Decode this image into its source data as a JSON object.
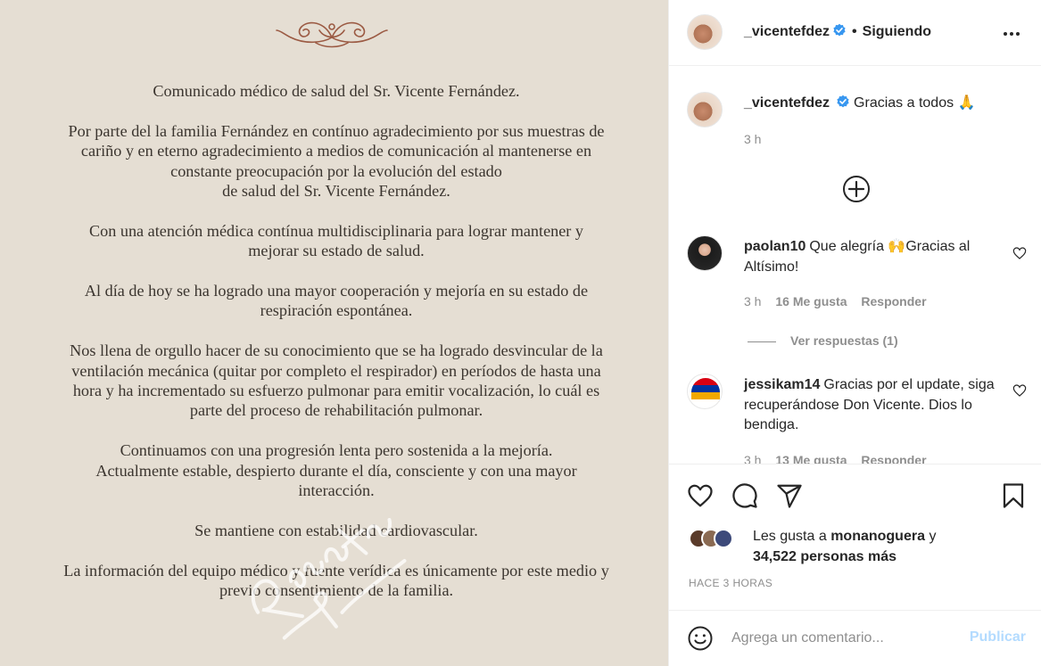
{
  "post": {
    "author": "_vicentefdez",
    "follow_separator": "•",
    "follow_status": "Siguiendo",
    "image": {
      "paragraphs": [
        "Comunicado médico de salud del Sr. Vicente Fernández.",
        "Por parte del la familia Fernández en contínuo agradecimiento por sus muestras de\ncariño y en eterno agradecimiento a medios de comunicación al mantenerse en\nconstante preocupación por la evolución del estado\nde salud del Sr. Vicente Fernández.",
        "Con una atención médica contínua multidisciplinaria para lograr mantener y\nmejorar su estado de salud.",
        "Al día de hoy se ha logrado una mayor cooperación y mejoría en su estado de\nrespiración espontánea.",
        "Nos llena de orgullo hacer de su conocimiento que se ha logrado desvincular de la\nventilación mecánica (quitar por completo el respirador) en períodos de hasta una\nhora y ha incrementado su esfuerzo pulmonar para emitir vocalización, lo cuál es\nparte del proceso de rehabilitación pulmonar.",
        "Continuamos con una progresión lenta pero sostenida a la mejoría.\nActualmente estable, despierto durante el día, consciente y con una mayor\ninteracción.",
        "Se mantiene con estabilidad cardiovascular.",
        "La información del equipo médico y fuente verídica es únicamente por este medio y\nprevio consentimiento de la familia."
      ],
      "watermark_text": "Vicente Fernández"
    },
    "caption": {
      "username": "_vicentefdez",
      "text": "Gracias a todos 🙏",
      "time": "3 h"
    }
  },
  "comments": [
    {
      "username": "paolan10",
      "text": "Que alegría 🙌Gracias al Altísimo!",
      "time": "3 h",
      "likes": "16 Me gusta",
      "reply": "Responder",
      "view_replies": "Ver respuestas (1)"
    },
    {
      "username": "jessikam14",
      "text": "Gracias por el update, siga recuperándose Don Vicente. Dios lo bendiga.",
      "time": "3 h",
      "likes": "13 Me gusta",
      "reply": "Responder"
    }
  ],
  "likes": {
    "prefix": "Les gusta a",
    "user": "monanoguera",
    "connector": "y",
    "count": "34,522 personas más"
  },
  "timestamp": "HACE 3 HORAS",
  "add_comment": {
    "placeholder": "Agrega un comentario...",
    "publish_label": "Publicar"
  },
  "colors": {
    "verified_blue": "#3897f0",
    "publish_disabled": "#b3dbff",
    "image_background": "#e5ded3",
    "ornament": "#9b5a43"
  },
  "icons": [
    "ornament-icon",
    "verified-icon",
    "more-options-icon",
    "add-circle-icon",
    "heart-icon",
    "comment-icon",
    "share-icon",
    "bookmark-icon",
    "emoji-icon"
  ]
}
